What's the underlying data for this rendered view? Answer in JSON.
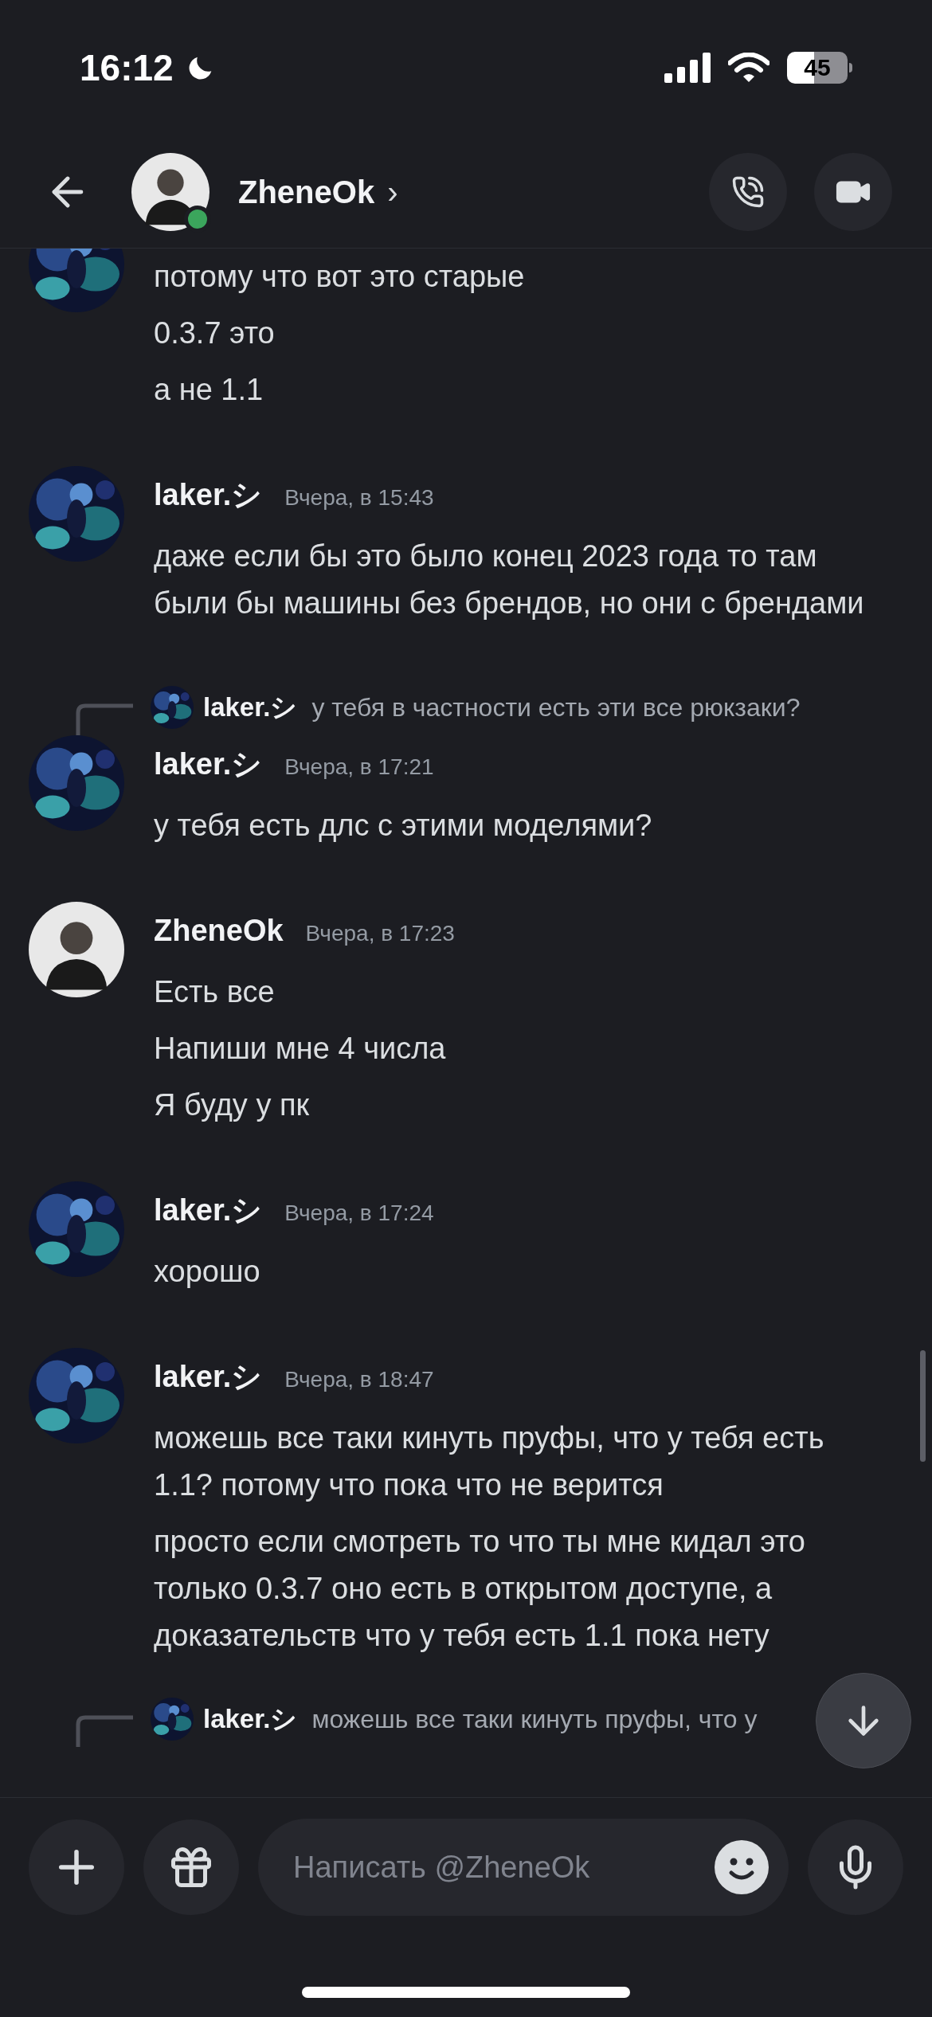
{
  "status_bar": {
    "time": "16:12",
    "battery": "45"
  },
  "header": {
    "name": "ZheneOk",
    "chevron": "›",
    "online": true
  },
  "groups": [
    {
      "kind": "picture",
      "messages": [
        "потому что вот это старые",
        "0.3.7 это",
        "а не 1.1"
      ]
    },
    {
      "kind": "picture",
      "author": "laker.シ",
      "time": "Вчера, в 15:43",
      "messages": [
        "даже если бы это было конец 2023 года то там были бы машины без брендов, но они с брендами"
      ]
    },
    {
      "kind": "picture",
      "reply": {
        "author": "laker.シ",
        "text": "у тебя в частности есть эти все рюкзаки?"
      },
      "author": "laker.シ",
      "time": "Вчера, в 17:21",
      "messages": [
        "у тебя есть длс с этими моделями?"
      ]
    },
    {
      "kind": "silhouette",
      "author": "ZheneOk",
      "time": "Вчера, в 17:23",
      "messages": [
        "Есть все",
        "Напиши мне 4 числа",
        "Я буду у пк"
      ]
    },
    {
      "kind": "picture",
      "author": "laker.シ",
      "time": "Вчера, в 17:24",
      "messages": [
        "хорошо"
      ]
    },
    {
      "kind": "picture",
      "author": "laker.シ",
      "time": "Вчера, в 18:47",
      "messages": [
        "можешь все таки кинуть пруфы, что у тебя есть 1.1? потому что пока что не верится",
        "просто если смотреть то что ты мне кидал это только 0.3.7 оно есть в открытом доступе, а доказательств что у тебя есть 1.1 пока нету"
      ]
    }
  ],
  "pending_reply": {
    "author": "laker.シ",
    "text": "можешь все таки кинуть пруфы, что у"
  },
  "composer": {
    "placeholder": "Написать @ZheneOk"
  }
}
